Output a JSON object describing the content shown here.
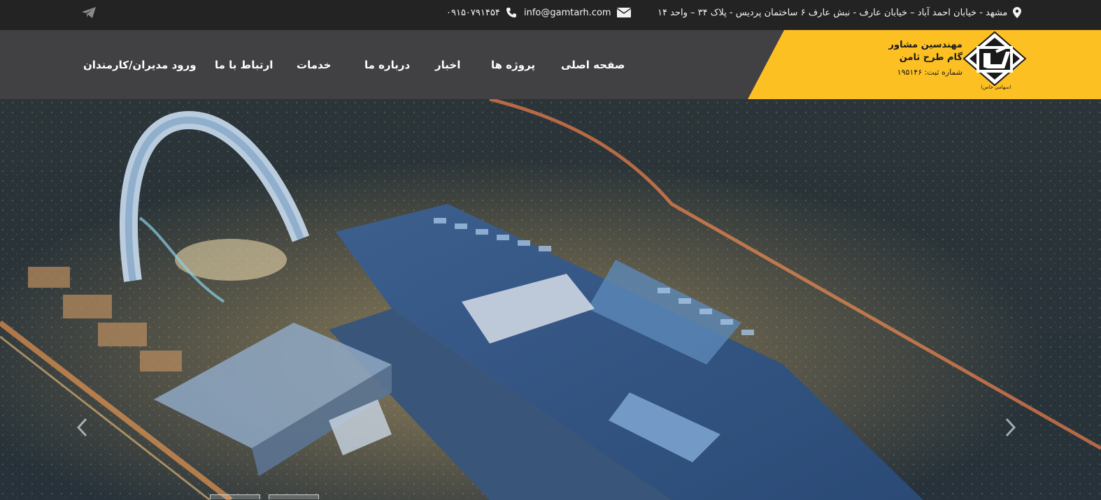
{
  "topbar": {
    "address": "مشهد - خیابان احمد آباد – خیابان عارف - نبش عارف ۶ ساختمان پردیس - پلاک ۳۴ – واحد ۱۴",
    "email": "info@gamtarh.com",
    "phone": "۰۹۱۵۰۷۹۱۴۵۴",
    "icons": {
      "address": "map-marker-icon",
      "email": "envelope-icon",
      "phone": "phone-icon",
      "social": "telegram-icon"
    }
  },
  "logo": {
    "line1": "مهندسین مشاور",
    "line2": "گام طرح ثامن",
    "line3": "شماره ثبت: ۱۹۵۱۴۶",
    "subtitle": "(سهامی خاص)"
  },
  "nav": {
    "items": [
      {
        "label": "صفحه اصلی"
      },
      {
        "label": "پروژه ها"
      },
      {
        "label": "اخبار"
      },
      {
        "label": "درباره ما"
      },
      {
        "label": "خدمات"
      },
      {
        "label": "ارتباط با ما"
      },
      {
        "label": "ورود مدیران/کارمندان"
      }
    ]
  },
  "hero": {
    "description_icon": "aerial-city-render",
    "prev_icon": "chevron-left-icon",
    "next_icon": "chevron-right-icon",
    "slides_count": 2,
    "active_slide": 2
  },
  "colors": {
    "topbar_bg": "#232323",
    "navbar_bg": "#414042",
    "logo_panel_bg": "#fdc023",
    "nav_text": "#ffffff"
  }
}
